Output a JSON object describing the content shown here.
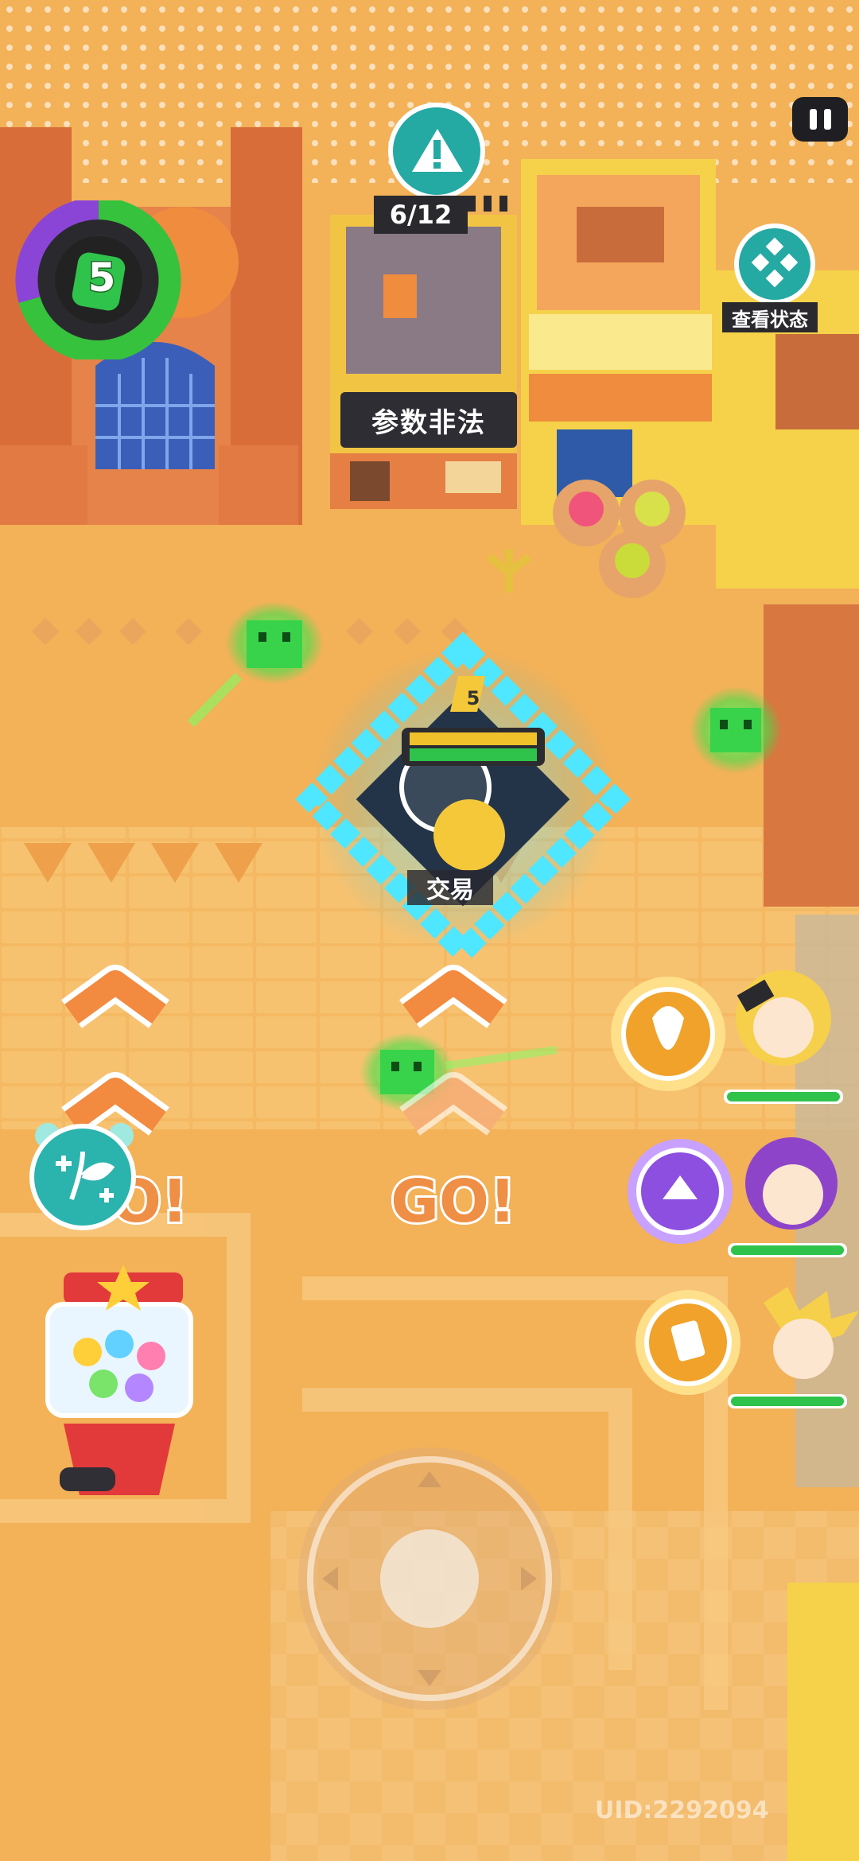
{
  "hud": {
    "level": "5",
    "quest_progress": "6/12",
    "view_status_label": "查看状态"
  },
  "map": {
    "building_sign": "参数非法",
    "trade_label": "交易",
    "go_label": "GO!",
    "go_label_partial": "O!",
    "enemy_level": "5"
  },
  "party": {
    "members": [
      {
        "icon": "heart-flame-skill-icon",
        "hp_fraction": 1.0,
        "accent": "#f0a22b"
      },
      {
        "icon": "crown-skill-icon",
        "hp_fraction": 1.0,
        "accent": "#8c4fe0"
      },
      {
        "icon": "card-skill-icon",
        "hp_fraction": 1.0,
        "accent": "#f0a22b"
      }
    ]
  },
  "footer": {
    "uid": "UID:2292094"
  },
  "colors": {
    "sand": "#f4b45a",
    "accent_teal": "#25a9a3",
    "hp_green": "#2fc34b",
    "dark_label": "#2a2a2e"
  }
}
